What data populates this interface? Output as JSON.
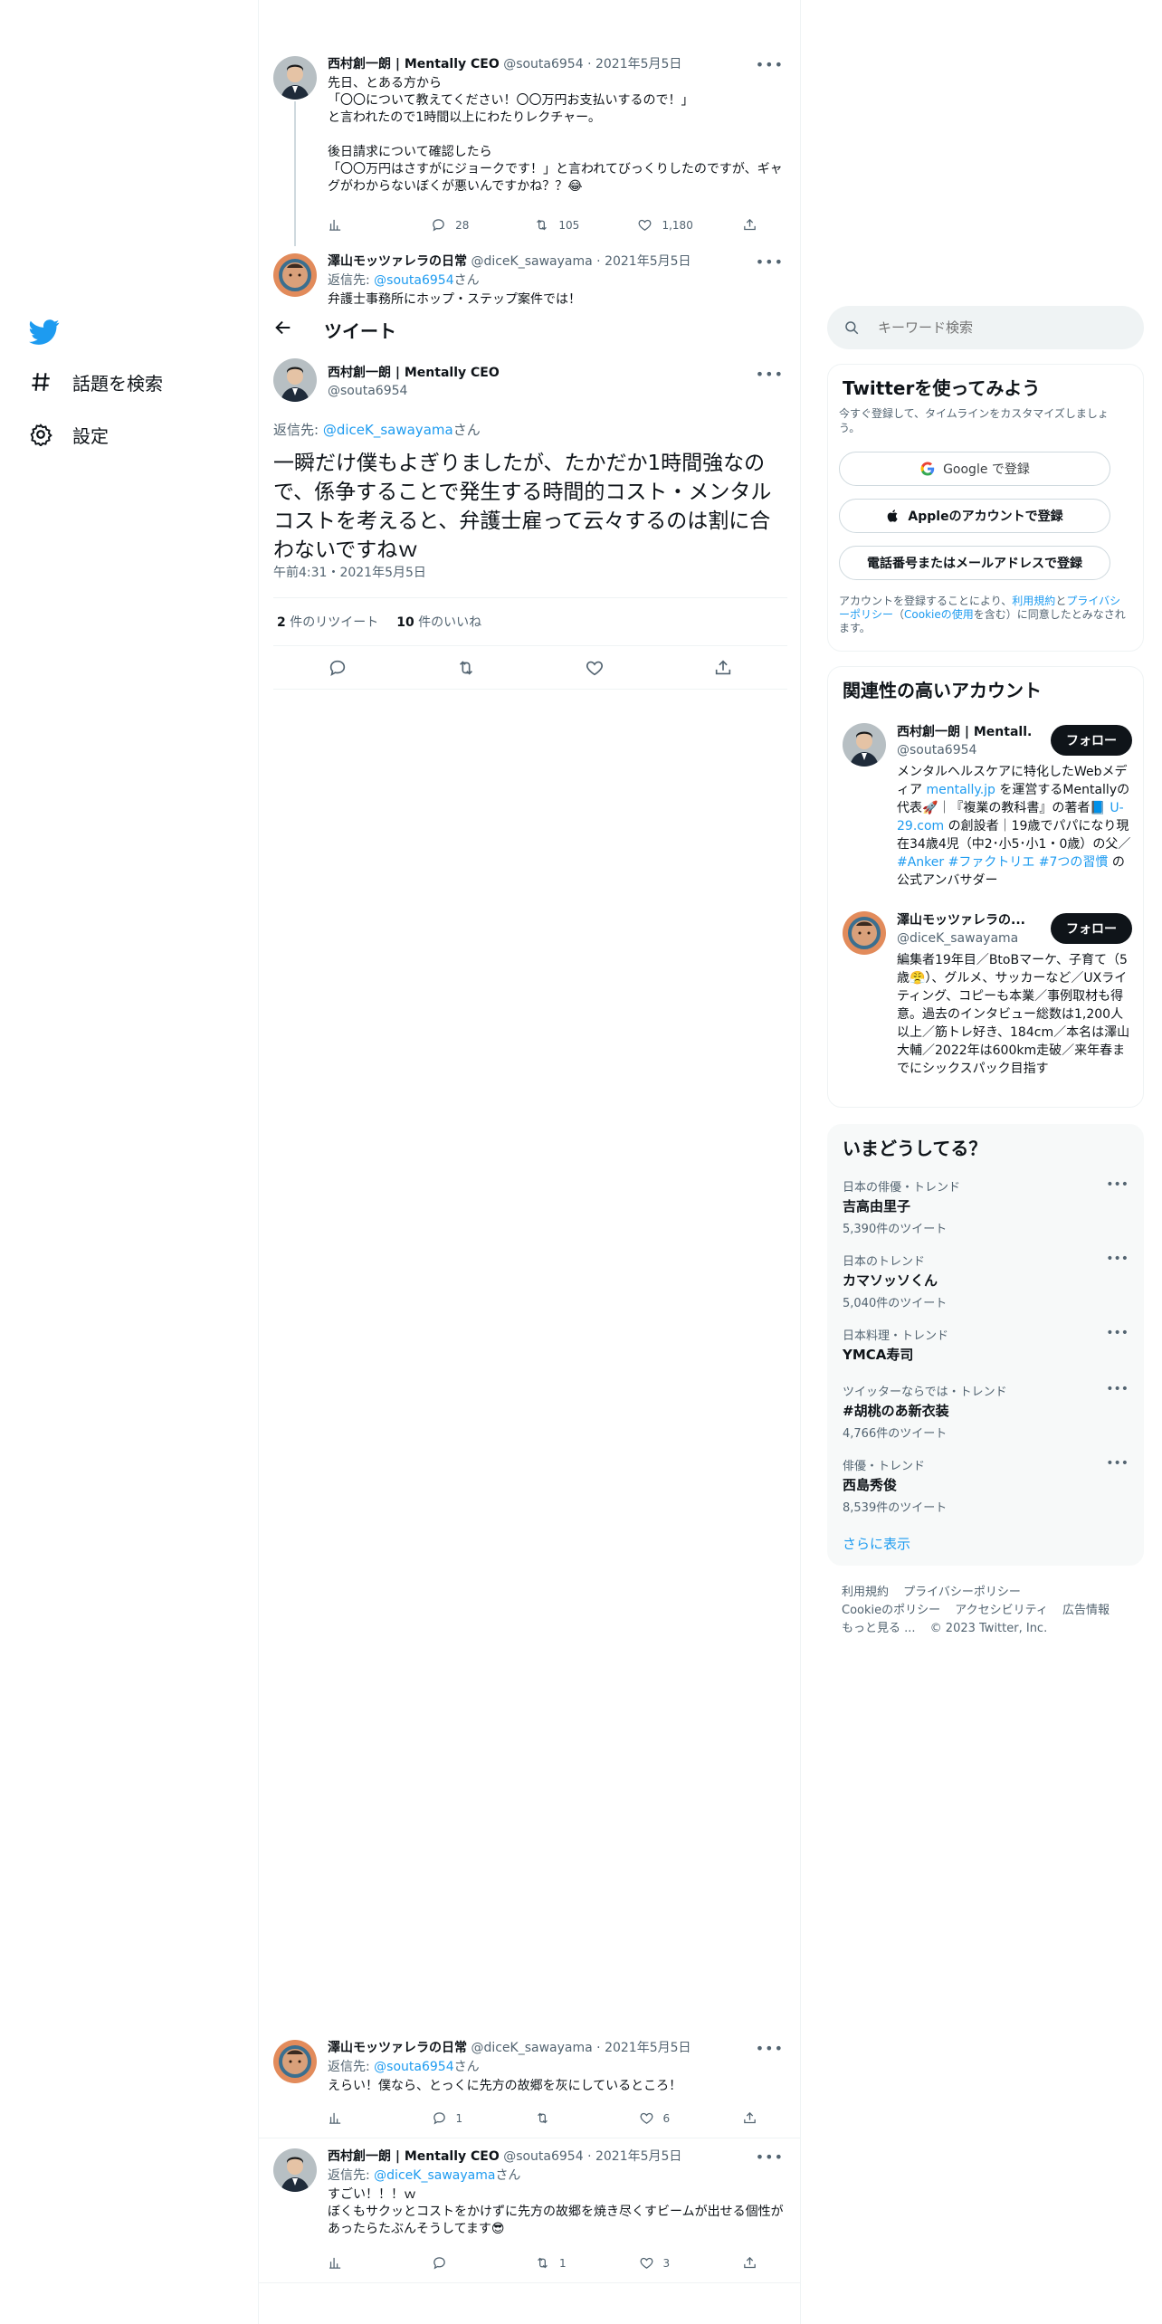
{
  "nav": {
    "items": [
      {
        "label": "話題を検索",
        "icon": "hashtag-icon"
      },
      {
        "label": "設定",
        "icon": "gear-icon"
      }
    ]
  },
  "header": {
    "title": "ツイート"
  },
  "thread_top": [
    {
      "name": "西村創一朗 | Mentally CEO",
      "handle": "@souta6954",
      "date": "2021年5月5日",
      "text": "先日、とある方から\n「〇〇について教えてください！〇〇万円お支払いするので！」\nと言われたので1時間以上にわたりレクチャー。\n\n後日請求について確認したら\n「〇〇万円はさすがにジョークです！」と言われてびっくりしたのですが、ギャグがわからないぼくが悪いんですかね？？😂",
      "replies": "28",
      "retweets": "105",
      "likes": "1,180"
    },
    {
      "name": "澤山モッツァレラの日常",
      "handle": "@diceK_sawayama",
      "date": "2021年5月5日",
      "reply_label": "返信先:",
      "reply_to": "@souta6954",
      "reply_suffix": "さん",
      "text": "弁護士事務所にホップ・ステップ案件では！"
    }
  ],
  "focus": {
    "name": "西村創一朗 | Mentally CEO",
    "handle": "@souta6954",
    "reply_label": "返信先:",
    "reply_to": "@diceK_sawayama",
    "reply_suffix": "さん",
    "text": "一瞬だけ僕もよぎりましたが、たかだか1時間強なので、係争することで発生する時間的コスト・メンタルコストを考えると、弁護士雇って云々するのは割に合わないですねｗ",
    "time": "午前4:31・2021年5月5日",
    "retweet_count": "2",
    "retweet_label": "件のリツイート",
    "like_count": "10",
    "like_label": "件のいいね"
  },
  "replies": [
    {
      "name": "澤山モッツァレラの日常",
      "handle": "@diceK_sawayama",
      "date": "2021年5月5日",
      "reply_label": "返信先:",
      "reply_to": "@souta6954",
      "reply_suffix": "さん",
      "text": "えらい！僕なら、とっくに先方の故郷を灰にしているところ！",
      "replies": "1",
      "retweets": "",
      "likes": "6"
    },
    {
      "name": "西村創一朗 | Mentally CEO",
      "handle": "@souta6954",
      "date": "2021年5月5日",
      "reply_label": "返信先:",
      "reply_to": "@diceK_sawayama",
      "reply_suffix": "さん",
      "text": "すごい！！！ｗ\nぼくもサクッとコストをかけずに先方の故郷を焼き尽くすビームが出せる個性があったらたぶんそうしてます😎",
      "replies": "",
      "retweets": "1",
      "likes": "3"
    }
  ],
  "search": {
    "placeholder": "キーワード検索"
  },
  "signup": {
    "title": "Twitterを使ってみよう",
    "subtitle": "今すぐ登録して、タイムラインをカスタマイズしましょう。",
    "google": "Google で登録",
    "apple": "Appleのアカウントで登録",
    "phone": "電話番号またはメールアドレスで登録",
    "terms_prefix": "アカウントを登録することにより、",
    "terms_link": "利用規約",
    "terms_and": "と",
    "privacy_link": "プライバシーポリシー",
    "cookie_open": "（",
    "cookie_link": "Cookieの使用",
    "terms_suffix": "を含む）に同意したとみなされます。"
  },
  "related": {
    "title": "関連性の高いアカウント",
    "follow_label": "フォロー",
    "accounts": [
      {
        "name": "西村創一朗 | Mentall...",
        "handle": "@souta6954",
        "bio_1": "メンタルヘルスケアに特化したWebメディア ",
        "bio_link1": "mentally.jp",
        "bio_2": " を運営するMentallyの代表🚀｜『複業の教科書』の著者📘 ",
        "bio_link2": "U-29.com",
        "bio_3": " の創設者｜19歳でパパになり現在34歳4児（中2･小5･小1・0歳）の父／ ",
        "bio_link3": "#Anker #ファクトリエ #7つの習慣",
        "bio_4": " の公式アンバサダー"
      },
      {
        "name": "澤山モッツァレラの...",
        "handle": "@diceK_sawayama",
        "bio": "編集者19年目／BtoBマーケ、子育て（5歳😤）、グルメ、サッカーなど／UXライティング、コピーも本業／事例取材も得意。過去のインタビュー総数は1,200人以上／筋トレ好き、184cm／本名は澤山大輔／2022年は600km走破／来年春までにシックスパック目指す"
      }
    ]
  },
  "trends": {
    "title": "いまどうしてる？",
    "items": [
      {
        "context": "日本の俳優・トレンド",
        "name": "吉高由里子",
        "count": "5,390件のツイート"
      },
      {
        "context": "日本のトレンド",
        "name": "カマソッソくん",
        "count": "5,040件のツイート"
      },
      {
        "context": "日本料理・トレンド",
        "name": "YMCA寿司",
        "count": ""
      },
      {
        "context": "ツイッターならでは・トレンド",
        "name": "#胡桃のあ新衣装",
        "count": "4,766件のツイート"
      },
      {
        "context": "俳優・トレンド",
        "name": "西島秀俊",
        "count": "8,539件のツイート"
      }
    ],
    "show_more": "さらに表示"
  },
  "footer": {
    "links": [
      "利用規約",
      "プライバシーポリシー",
      "Cookieのポリシー",
      "アクセシビリティ",
      "広告情報",
      "もっと見る ..."
    ],
    "copyright": "© 2023 Twitter, Inc."
  },
  "colors": {
    "accent": "#1d9bf0",
    "text": "#0f1419",
    "muted": "#536471",
    "border": "#eff3f4"
  }
}
